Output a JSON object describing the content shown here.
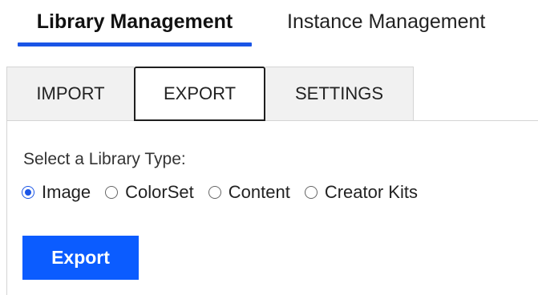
{
  "top_nav": {
    "tabs": [
      {
        "label": "Library Management",
        "active": true
      },
      {
        "label": "Instance Management",
        "active": false
      }
    ]
  },
  "sub_tabs": {
    "tabs": [
      {
        "label": "IMPORT",
        "active": false
      },
      {
        "label": "EXPORT",
        "active": true
      },
      {
        "label": "SETTINGS",
        "active": false
      }
    ]
  },
  "export_panel": {
    "library_type_label": "Select a Library Type:",
    "library_type_options": [
      {
        "label": "Image",
        "checked": true
      },
      {
        "label": "ColorSet",
        "checked": false
      },
      {
        "label": "Content",
        "checked": false
      },
      {
        "label": "Creator Kits",
        "checked": false
      }
    ],
    "export_button_label": "Export"
  },
  "colors": {
    "accent": "#1a55e6",
    "button_bg": "#0b5cff",
    "tab_bg": "#f1f1f1"
  }
}
